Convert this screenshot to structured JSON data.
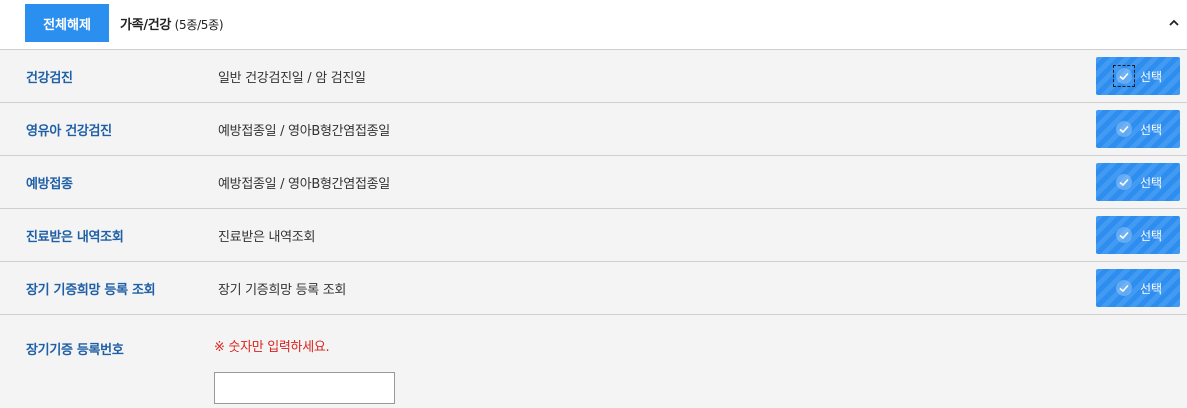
{
  "header": {
    "clear_all_label": "전체해제",
    "category_name": "가족/건강",
    "category_count": " (5종/5종)",
    "collapse_icon": "chevron-up-icon"
  },
  "rows": [
    {
      "label": "건강검진",
      "description": "일반 건강검진일 / 암 검진일",
      "button_label": "선택",
      "focused": true
    },
    {
      "label": "영유아 건강검진",
      "description": "예방접종일 / 영아B형간염접종일",
      "button_label": "선택"
    },
    {
      "label": "예방접종",
      "description": "예방접종일 / 영아B형간염접종일",
      "button_label": "선택"
    },
    {
      "label": "진료받은 내역조회",
      "description": "진료받은 내역조회",
      "button_label": "선택"
    },
    {
      "label": "장기 기증희망 등록 조회",
      "description": "장기 기증희망 등록 조회",
      "button_label": "선택"
    }
  ],
  "registration": {
    "label": "장기기증 등록번호",
    "notice": "※ 숫자만 입력하세요.",
    "input_value": ""
  },
  "colors": {
    "primary_blue": "#2b8ff0",
    "label_blue": "#1f5fa6",
    "notice_red": "#d9231f",
    "row_bg": "#f4f4f4"
  },
  "icons": {
    "select_button_icon": "check-circle-icon"
  }
}
